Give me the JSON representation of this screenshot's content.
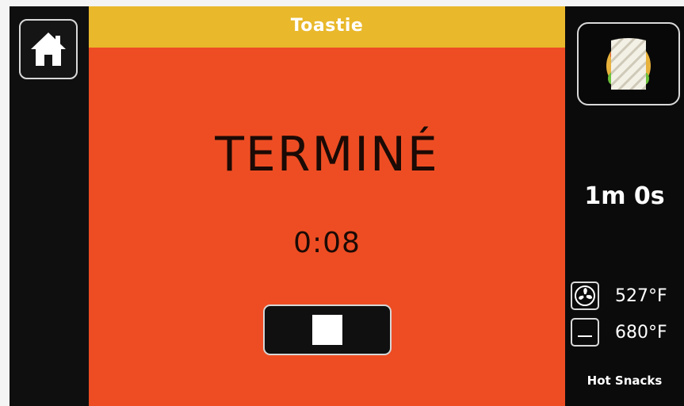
{
  "header": {
    "title": "Toastie"
  },
  "main": {
    "status": "TERMINÉ",
    "timer": "0:08"
  },
  "sidebar": {
    "recipe_icon": "sandwich-icon",
    "cook_time": "1m 0s",
    "fan_temp": "527°F",
    "element_temp": "680°F",
    "mode": "Hot Snacks"
  },
  "icons": {
    "home": "home-icon",
    "stop": "stop-icon",
    "fan": "fan-icon",
    "element": "heating-element-icon"
  },
  "colors": {
    "title_bar": "#e9b82b",
    "main_bg": "#ee4d23",
    "side_bg": "#0b0b0b",
    "text_dark": "#1b0a05"
  }
}
